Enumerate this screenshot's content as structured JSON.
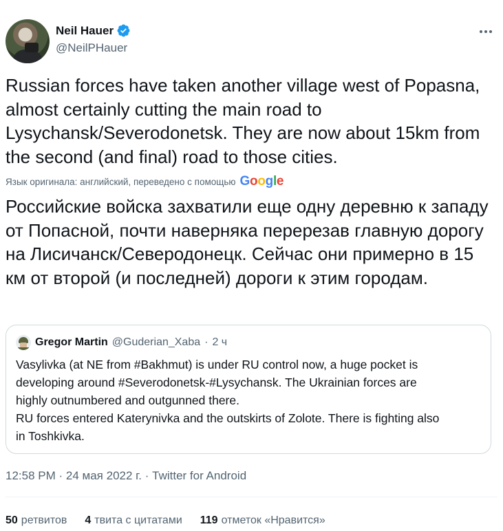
{
  "author": {
    "name": "Neil Hauer",
    "handle": "@NeilPHauer"
  },
  "tweet": {
    "text": "Russian forces have taken another village west of Popasna, almost certainly cutting the main road to Lysychansk/Severodonetsk. They are now about 15km from the second (and final) road to those cities.",
    "translation_label": "Язык оригинала: английский, переведено с помощью",
    "translated_text": "Российские войска захватили еще одну деревню к западу от Попасной, почти наверняка перерезав главную дорогу на Лисичанск/Северодонецк. Сейчас они примерно в 15 км от второй (и последней) дороги к этим городам."
  },
  "quote": {
    "name": "Gregor Martin",
    "handle": "@Guderian_Xaba",
    "separator": "·",
    "time": "2 ч",
    "lines": [
      "Vasylivka (at NE from #Bakhmut) is under RU control now, a huge pocket is",
      "developing around #Severodonetsk-#Lysychansk. The Ukrainian forces are",
      "highly outnumbered and outgunned there.",
      "RU forces entered Katerynivka and the outskirts of Zolote. There is fighting also",
      "in Toshkivka."
    ]
  },
  "meta": {
    "time": "12:58 PM",
    "sep1": "·",
    "date": "24 мая 2022 г.",
    "sep2": "·",
    "source": "Twitter for Android"
  },
  "stats": {
    "retweets_count": "50",
    "retweets_label": "ретвитов",
    "quotes_count": "4",
    "quotes_label": "твита с цитатами",
    "likes_count": "119",
    "likes_label": "отметок «Нравится»"
  },
  "colors": {
    "text": "#0f1419",
    "secondary": "#536471",
    "border": "#cfd9de",
    "verified": "#1d9bf0"
  },
  "icons": {
    "verified": "verified-badge-icon",
    "more": "more-options-icon",
    "google": "google-logo"
  }
}
